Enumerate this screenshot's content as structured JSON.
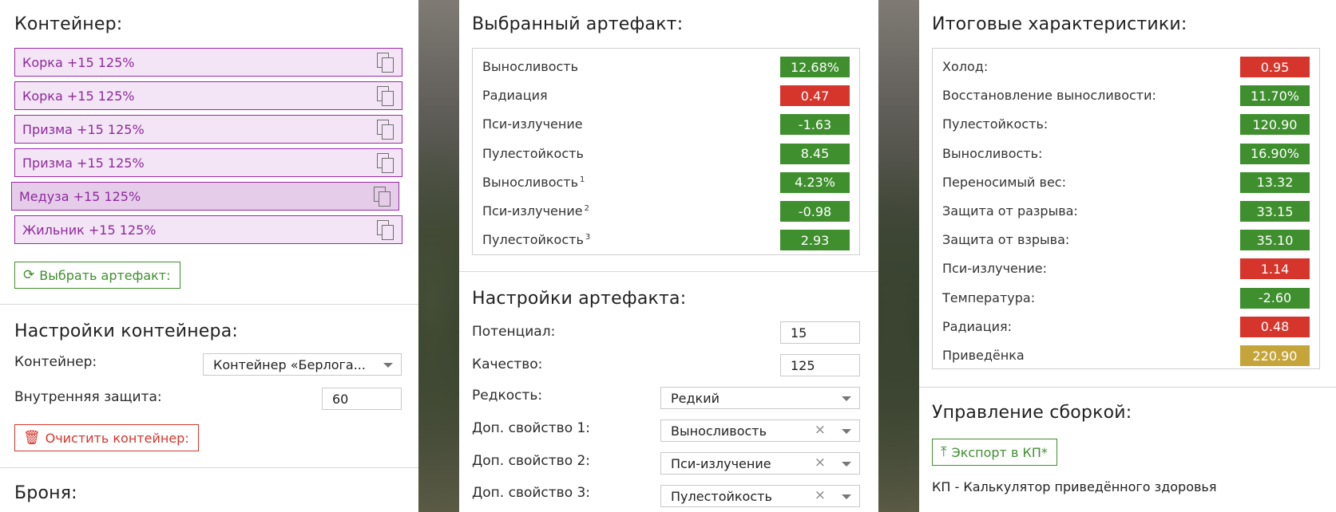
{
  "colors": {
    "green": "#3f8f2f",
    "red": "#d6352c",
    "gold": "#c5a43a",
    "purple": "#9b2aa8"
  },
  "container": {
    "title": "Контейнер:",
    "slots": [
      {
        "label": "Корка +15 125%",
        "icon": "copy-icon"
      },
      {
        "label": "Корка +15 125%",
        "icon": "copy-icon"
      },
      {
        "label": "Призма +15 125%",
        "icon": "copy-icon"
      },
      {
        "label": "Призма +15 125%",
        "icon": "copy-icon"
      },
      {
        "label": "Медуза +15 125%",
        "icon": "copy-icon",
        "selected": true
      },
      {
        "label": "Жильник +15 125%",
        "icon": "copy-icon"
      }
    ],
    "choose_button": "Выбрать артефакт:",
    "choose_icon": "refresh-icon"
  },
  "container_settings": {
    "title": "Настройки контейнера:",
    "container_label": "Контейнер:",
    "container_value": "Контейнер «Берлога...",
    "protection_label": "Внутренняя защита:",
    "protection_value": "60",
    "clear_button": "Очистить контейнер:",
    "clear_icon": "trash-icon"
  },
  "armor": {
    "title": "Броня:"
  },
  "selected_artifact": {
    "title": "Выбранный артефакт:",
    "stats": [
      {
        "name": "Выносливость",
        "sup": "",
        "value": "12.68%",
        "color": "green"
      },
      {
        "name": "Радиация",
        "sup": "",
        "value": "0.47",
        "color": "red"
      },
      {
        "name": "Пси-излучение",
        "sup": "",
        "value": "-1.63",
        "color": "green"
      },
      {
        "name": "Пулестойкость",
        "sup": "",
        "value": "8.45",
        "color": "green"
      },
      {
        "name": "Выносливость",
        "sup": "1",
        "value": "4.23%",
        "color": "green"
      },
      {
        "name": "Пси-излучение",
        "sup": "2",
        "value": "-0.98",
        "color": "green"
      },
      {
        "name": "Пулестойкость",
        "sup": "3",
        "value": "2.93",
        "color": "green"
      }
    ]
  },
  "artifact_settings": {
    "title": "Настройки артефакта:",
    "potential_label": "Потенциал:",
    "potential_value": "15",
    "quality_label": "Качество:",
    "quality_value": "125",
    "rarity_label": "Редкость:",
    "rarity_value": "Редкий",
    "extra1_label": "Доп. свойство 1:",
    "extra1_value": "Выносливость",
    "extra2_label": "Доп. свойство 2:",
    "extra2_value": "Пси-излучение",
    "extra3_label": "Доп. свойство 3:",
    "extra3_value": "Пулестойкость",
    "clear_symbol": "×"
  },
  "totals": {
    "title": "Итоговые характеристики:",
    "stats": [
      {
        "name": "Холод:",
        "value": "0.95",
        "color": "red"
      },
      {
        "name": "Восстановление выносливости:",
        "value": "11.70%",
        "color": "green"
      },
      {
        "name": "Пулестойкость:",
        "value": "120.90",
        "color": "green"
      },
      {
        "name": "Выносливость:",
        "value": "16.90%",
        "color": "green"
      },
      {
        "name": "Переносимый вес:",
        "value": "13.32",
        "color": "green"
      },
      {
        "name": "Защита от разрыва:",
        "value": "33.15",
        "color": "green"
      },
      {
        "name": "Защита от взрыва:",
        "value": "35.10",
        "color": "green"
      },
      {
        "name": "Пси-излучение:",
        "value": "1.14",
        "color": "red"
      },
      {
        "name": "Температура:",
        "value": "-2.60",
        "color": "green"
      },
      {
        "name": "Радиация:",
        "value": "0.48",
        "color": "red"
      },
      {
        "name": "Приведёнка",
        "value": "220.90",
        "color": "gold"
      }
    ]
  },
  "build": {
    "title": "Управление сборкой:",
    "export_button": "Экспорт в КП*",
    "export_icon": "upload-icon",
    "note": "КП - Калькулятор приведённого здоровья"
  }
}
